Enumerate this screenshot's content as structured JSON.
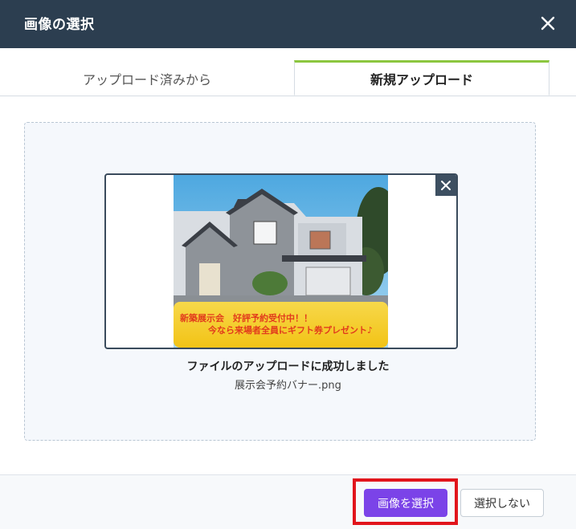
{
  "dialog": {
    "title": "画像の選択",
    "close_icon": "close-icon"
  },
  "tabs": [
    {
      "label": "アップロード済みから",
      "active": false
    },
    {
      "label": "新規アップロード",
      "active": true
    }
  ],
  "upload": {
    "preview_alt": "展示会予約バナー",
    "banner_line1": "新築展示会　好評予約受付中！！",
    "banner_line2": "今なら来場者全員にギフト券プレゼント♪",
    "status": "ファイルのアップロードに成功しました",
    "filename": "展示会予約バナー.png",
    "remove_icon": "close-icon"
  },
  "footer": {
    "select_label": "画像を選択",
    "cancel_label": "選択しない"
  },
  "colors": {
    "header_bg": "#2c3e50",
    "tab_accent": "#8cc63f",
    "primary": "#7b43e8",
    "highlight": "#e1151c"
  }
}
